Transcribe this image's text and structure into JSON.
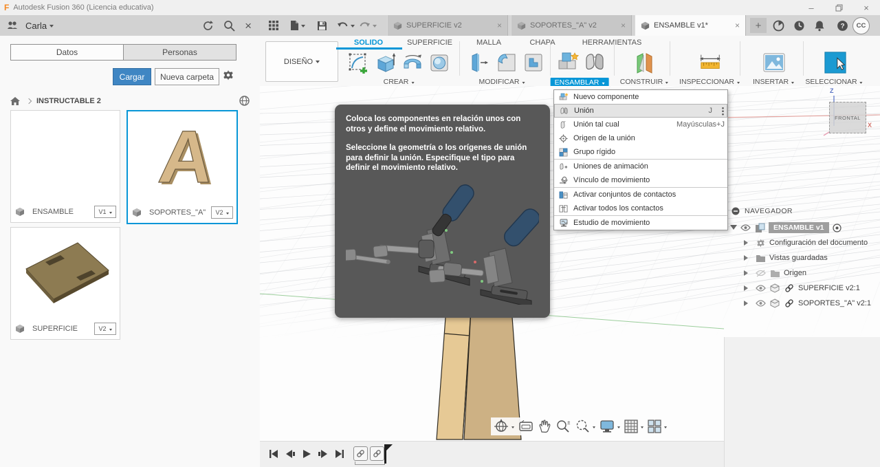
{
  "window": {
    "title": "Autodesk Fusion 360 (Licencia educativa)",
    "minimize": "–",
    "close": "×"
  },
  "left_panel": {
    "user": "Carla",
    "tabs": [
      {
        "label": "Datos"
      },
      {
        "label": "Personas"
      }
    ],
    "upload_button": "Cargar",
    "new_folder_button": "Nueva carpeta",
    "breadcrumb": "INSTRUCTABLE 2",
    "cards": [
      {
        "name": "ENSAMBLE",
        "version": "V1"
      },
      {
        "name": "SOPORTES_\"A\"",
        "version": "V2"
      },
      {
        "name": "SUPERFICIE",
        "version": "V2"
      }
    ]
  },
  "doc_tabs": [
    {
      "label": "SUPERFICIE v2"
    },
    {
      "label": "SOPORTES_\"A\" v2"
    },
    {
      "label": "ENSAMBLE v1*"
    }
  ],
  "misc": {
    "close_tab": "×",
    "new_tab": "+",
    "avatar": "CC",
    "help": "?"
  },
  "ribbon": {
    "workspace": "DISEÑO",
    "tabs": [
      {
        "label": "SOLIDO"
      },
      {
        "label": "SUPERFICIE"
      },
      {
        "label": "MALLA"
      },
      {
        "label": "CHAPA"
      },
      {
        "label": "HERRAMIENTAS"
      }
    ],
    "groups": [
      {
        "label": "CREAR"
      },
      {
        "label": "MODIFICAR"
      },
      {
        "label": "ENSAMBLAR"
      },
      {
        "label": "CONSTRUIR"
      },
      {
        "label": "INSPECCIONAR"
      },
      {
        "label": "INSERTAR"
      },
      {
        "label": "SELECCIONAR"
      }
    ]
  },
  "assemble_menu": {
    "items": [
      {
        "label": "Nuevo componente",
        "shortcut": ""
      },
      {
        "label": "Unión",
        "shortcut": "J"
      },
      {
        "label": "Unión tal cual",
        "shortcut": "Mayúsculas+J"
      },
      {
        "label": "Origen de la unión",
        "shortcut": ""
      },
      {
        "label": "Grupo rígido",
        "shortcut": ""
      },
      {
        "label": "Uniones de animación",
        "shortcut": ""
      },
      {
        "label": "Vínculo de movimiento",
        "shortcut": ""
      },
      {
        "label": "Activar conjuntos de contactos",
        "shortcut": ""
      },
      {
        "label": "Activar todos los contactos",
        "shortcut": ""
      },
      {
        "label": "Estudio de movimiento",
        "shortcut": ""
      }
    ]
  },
  "tooltip": {
    "p1": "Coloca los componentes en relación unos con otros y define el movimiento relativo.",
    "p2": "Seleccione la geometría o los orígenes de unión para definir la unión. Especifique el tipo para definir el movimiento relativo."
  },
  "navigator": {
    "title": "NAVEGADOR",
    "root": "ENSAMBLE v1",
    "rows": [
      {
        "label": "Configuración del documento"
      },
      {
        "label": "Vistas guardadas"
      },
      {
        "label": "Origen"
      },
      {
        "label": "SUPERFICIE v2:1"
      },
      {
        "label": "SOPORTES_\"A\" v2:1"
      }
    ]
  },
  "viewcube": {
    "face": "FRONTAL",
    "axis_z": "Z",
    "axis_x": "X"
  },
  "colors": {
    "accent": "#0696d7",
    "upload_blue": "#3f86c3",
    "wood_light": "#e6c693",
    "wood_dark": "#cdb07e",
    "tooltip_bg": "#585858"
  }
}
